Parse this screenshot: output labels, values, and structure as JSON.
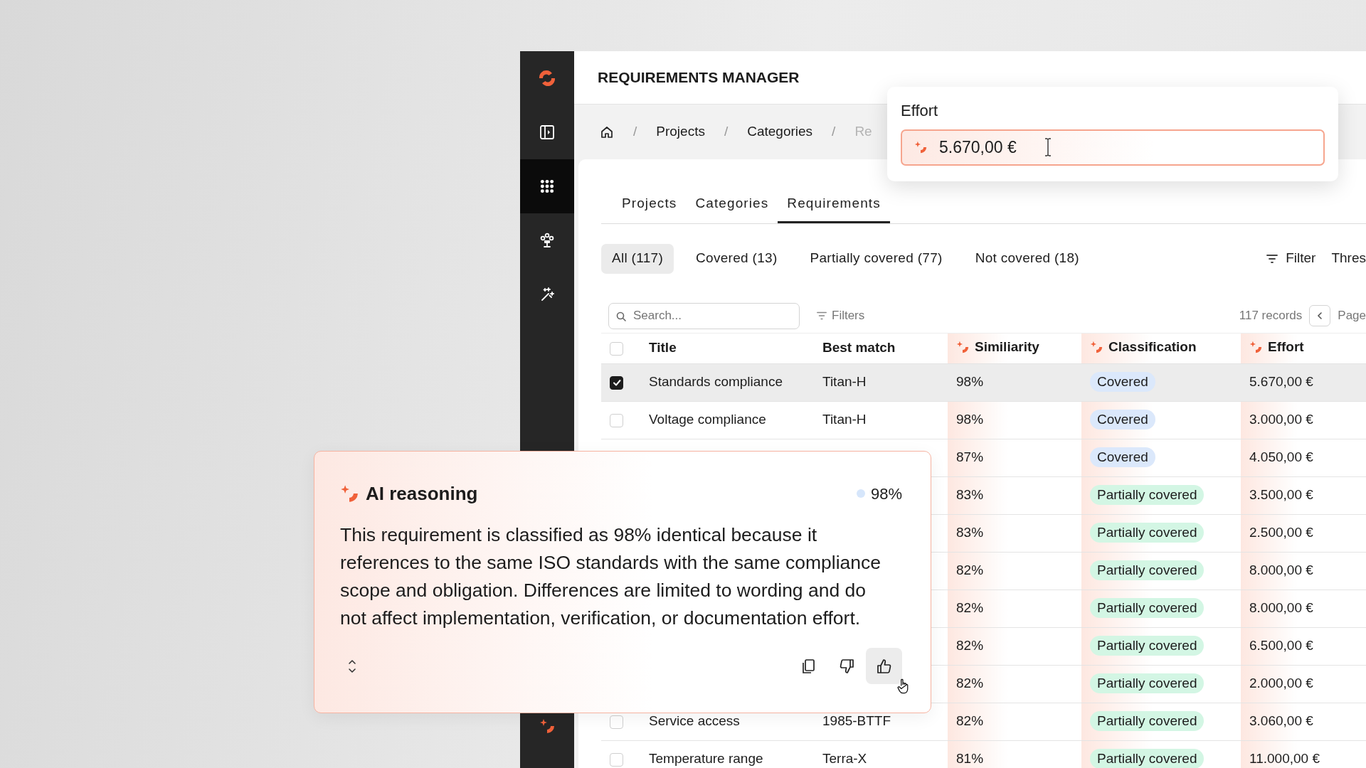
{
  "sidebar": {
    "items": [
      {
        "kind": "logo",
        "selected": false
      },
      {
        "kind": "panel",
        "selected": false
      },
      {
        "kind": "grid",
        "selected": true
      },
      {
        "kind": "network",
        "selected": false
      },
      {
        "kind": "wand",
        "selected": false
      }
    ],
    "bottom_items": [
      {
        "kind": "ai",
        "selected": false
      }
    ]
  },
  "header": {
    "title": "REQUIREMENTS MANAGER"
  },
  "breadcrumbs": [
    {
      "kind": "home"
    },
    {
      "kind": "separator",
      "label": "/"
    },
    {
      "kind": "link",
      "label": "Projects"
    },
    {
      "kind": "separator",
      "label": "/"
    },
    {
      "kind": "link",
      "label": "Categories"
    },
    {
      "kind": "separator",
      "label": "/"
    },
    {
      "kind": "current",
      "label": "Re"
    }
  ],
  "tabs": [
    {
      "label": "Projects",
      "selected": false
    },
    {
      "label": "Categories",
      "selected": false
    },
    {
      "label": "Requirements",
      "selected": true
    }
  ],
  "status_filters": [
    {
      "label": "All (117)",
      "selected": true
    },
    {
      "label": "Covered (13)",
      "selected": false
    },
    {
      "label": "Partially covered (77)",
      "selected": false
    },
    {
      "label": "Not covered (18)",
      "selected": false
    }
  ],
  "toolbar_right": {
    "filter": "Filter",
    "threshold": "Thres"
  },
  "search": {
    "placeholder": "Search..."
  },
  "filters_button": "Filters",
  "records": "117 records",
  "page_label": "Page",
  "table": {
    "header_checked": false,
    "columns": [
      {
        "label": "Title",
        "ai": false
      },
      {
        "label": "Best match",
        "ai": false
      },
      {
        "label": "Similiarity",
        "ai": true
      },
      {
        "label": "Classification",
        "ai": true
      },
      {
        "label": "Effort",
        "ai": true
      }
    ],
    "rows": [
      {
        "checked": true,
        "title": "Standards compliance",
        "best_match": "Titan-H",
        "similarity": "98%",
        "classification": "Covered",
        "color": "#dbe8fb",
        "effort": "5.670,00 €"
      },
      {
        "checked": false,
        "title": "Voltage compliance",
        "best_match": "Titan-H",
        "similarity": "98%",
        "classification": "Covered",
        "color": "#dbe8fb",
        "effort": "3.000,00 €"
      },
      {
        "similarity": "87%",
        "classification": "Covered",
        "color": "#dbe8fb",
        "effort": "4.050,00 €"
      },
      {
        "similarity": "83%",
        "classification": "Partially covered",
        "color": "#d3f6e4",
        "effort": "3.500,00 €"
      },
      {
        "similarity": "83%",
        "classification": "Partially covered",
        "color": "#d3f6e4",
        "effort": "2.500,00 €"
      },
      {
        "similarity": "82%",
        "classification": "Partially covered",
        "color": "#d3f6e4",
        "effort": "8.000,00 €"
      },
      {
        "similarity": "82%",
        "classification": "Partially covered",
        "color": "#d3f6e4",
        "effort": "8.000,00 €"
      },
      {
        "similarity": "82%",
        "classification": "Partially covered",
        "color": "#d3f6e4",
        "effort": "6.500,00 €"
      },
      {
        "similarity": "82%",
        "classification": "Partially covered",
        "color": "#d3f6e4",
        "effort": "2.000,00 €"
      },
      {
        "checked": false,
        "title": "Service access",
        "best_match": "1985-BTTF",
        "similarity": "82%",
        "classification": "Partially covered",
        "color": "#d3f6e4",
        "effort": "3.060,00 €"
      },
      {
        "checked": false,
        "title": "Temperature range",
        "best_match": "Terra-X",
        "similarity": "81%",
        "classification": "Partially covered",
        "color": "#d3f6e4",
        "effort": "11.000,00 €"
      }
    ]
  },
  "effort_popup": {
    "label": "Effort",
    "value": "5.670,00 €"
  },
  "ai_card": {
    "title": "AI reasoning",
    "score": {
      "text": "98%",
      "color": "#d6e6fb"
    },
    "text": "This requirement is classified as 98% identical because it references to the same ISO standards with the same compliance scope and obligation. Differences are limited to wording and do not affect implementation, verification, or documentation effort.",
    "actions": [
      {
        "kind": "copy",
        "hovered": false
      },
      {
        "kind": "dislike",
        "hovered": false
      },
      {
        "kind": "like",
        "hovered": true
      }
    ]
  }
}
